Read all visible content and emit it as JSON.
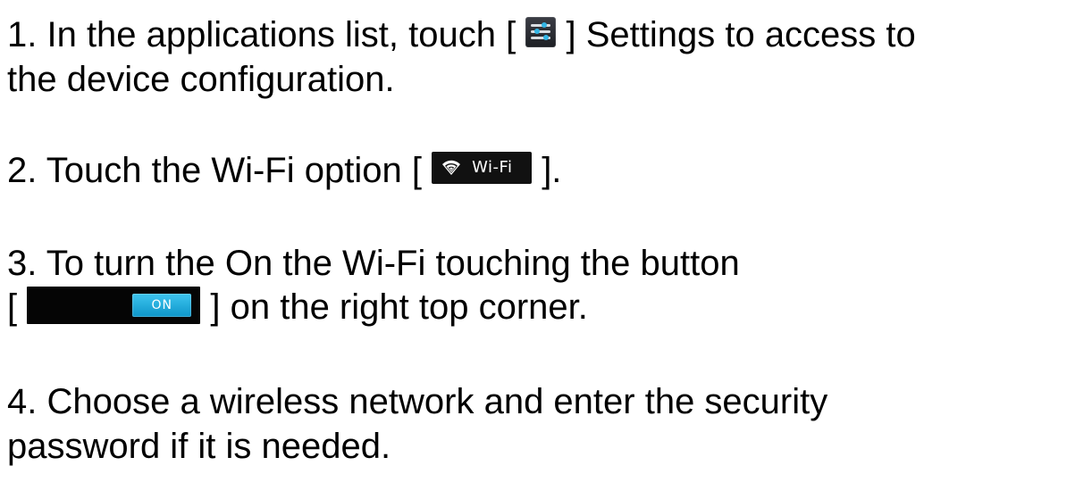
{
  "steps": {
    "step1": {
      "line1_before": "1. In the applications list, touch [",
      "line1_after": "] Settings to access to",
      "line2": "the device configuration.",
      "icon": "settings-icon"
    },
    "step2": {
      "before": "2. Touch the Wi-Fi option [",
      "after": "].",
      "icon": "wifi-icon",
      "inline_label": "Wi-Fi"
    },
    "step3": {
      "line1": "3. To turn the On the Wi-Fi touching the button",
      "line2_before": "[",
      "line2_after": "] on the right top corner.",
      "toggle_label": "ON"
    },
    "step4": {
      "line1": "4. Choose a wireless network and enter the security",
      "line2": "password if it is needed."
    }
  },
  "colors": {
    "text": "#000000",
    "background": "#ffffff",
    "accent": "#33b5e5",
    "dark_icon_bg": "#111111"
  }
}
